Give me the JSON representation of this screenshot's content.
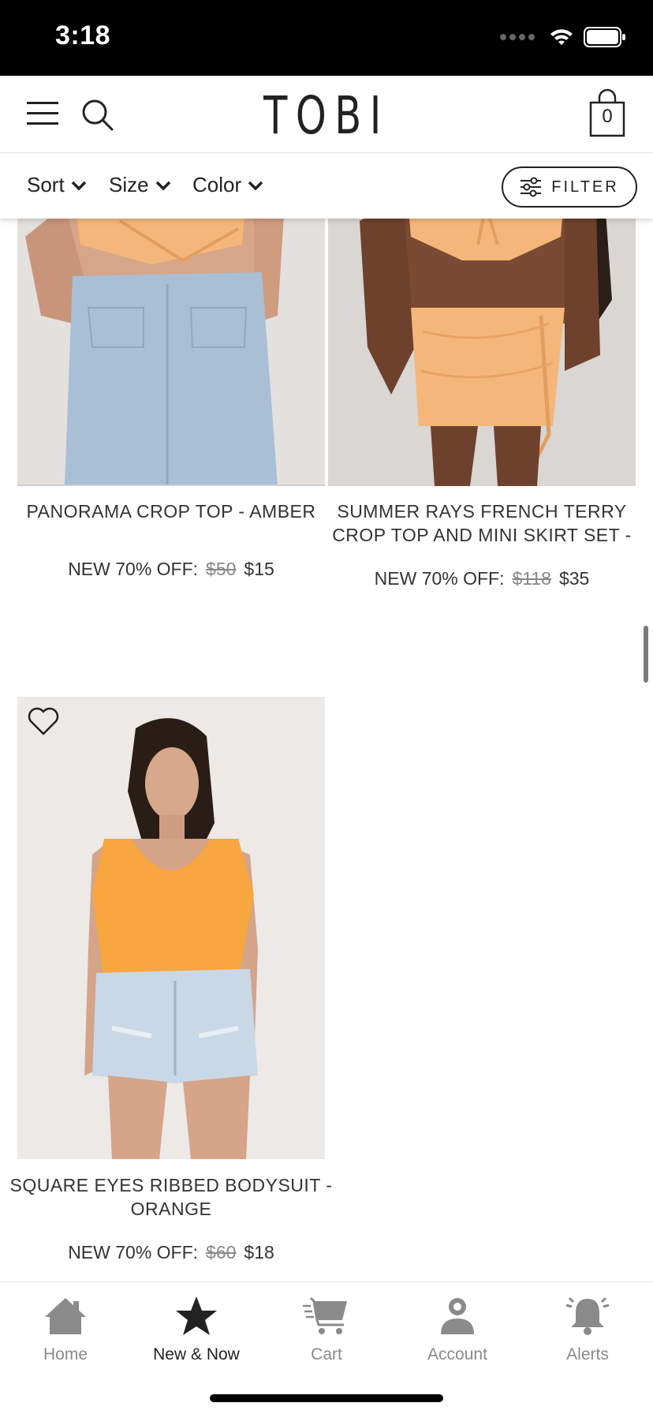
{
  "status_bar": {
    "time": "3:18"
  },
  "header": {
    "logo": "TOBI",
    "cart_count": "0"
  },
  "filters": {
    "sort_label": "Sort",
    "size_label": "Size",
    "color_label": "Color",
    "filter_label": "FILTER"
  },
  "products": [
    {
      "name_line1": "PANORAMA CROP TOP - AMBER",
      "price_prefix": "NEW 70% OFF:",
      "old_price": "$50",
      "new_price": "$15"
    },
    {
      "name_line1": "SUMMER RAYS FRENCH TERRY",
      "name_line2": "CROP TOP AND MINI SKIRT SET -",
      "price_prefix": "NEW 70% OFF:",
      "old_price": "$118",
      "new_price": "$35"
    },
    {
      "name_line1": "SQUARE EYES RIBBED BODYSUIT -",
      "name_line2": "ORANGE",
      "price_prefix": "NEW 70% OFF:",
      "old_price": "$60",
      "new_price": "$18"
    }
  ],
  "tabs": [
    {
      "label": "Home",
      "icon": "home-icon"
    },
    {
      "label": "New & Now",
      "icon": "star-icon"
    },
    {
      "label": "Cart",
      "icon": "cart-icon"
    },
    {
      "label": "Account",
      "icon": "account-icon"
    },
    {
      "label": "Alerts",
      "icon": "bell-icon"
    }
  ],
  "colors": {
    "status_bar_bg": "#000000",
    "active_tab": "#222222",
    "inactive_tab": "#8a8a8a",
    "peach_top": "#f5b779",
    "orange_bodysuit": "#f7a640",
    "denim": "#a9bfd6"
  }
}
